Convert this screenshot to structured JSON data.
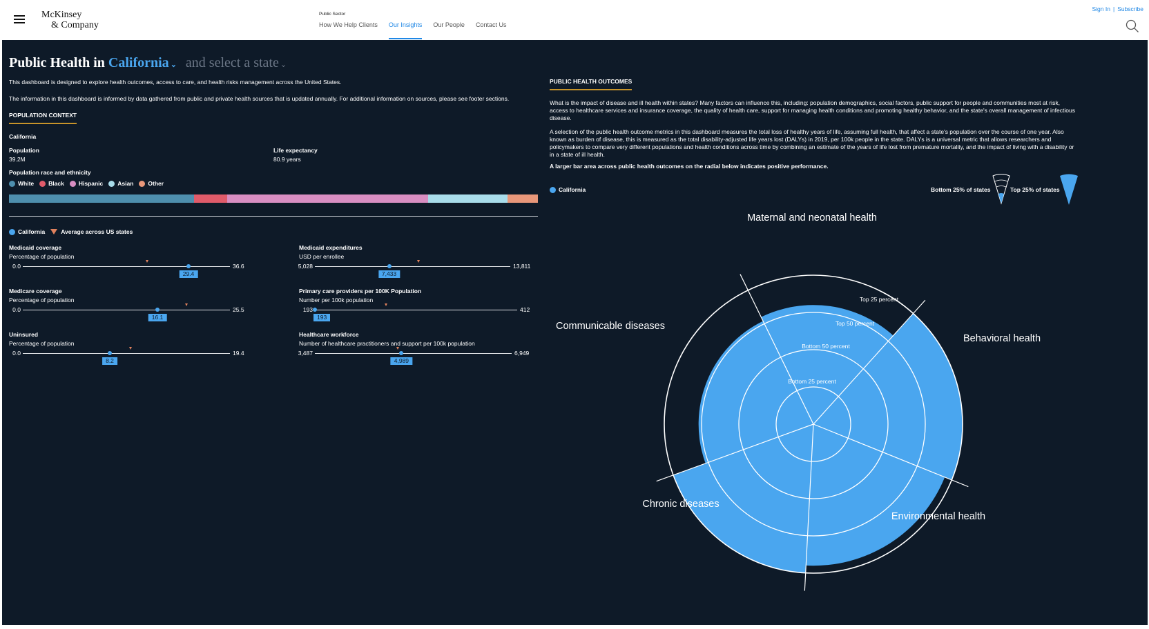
{
  "nav": {
    "logo_line1": "McKinsey",
    "logo_line2": "& Company",
    "sector": "Public Sector",
    "links": [
      "How We Help Clients",
      "Our Insights",
      "Our People",
      "Contact Us"
    ],
    "active_link": "Our Insights",
    "sign_in": "Sign In",
    "separator": "|",
    "subscribe": "Subscribe"
  },
  "header": {
    "title_prefix": "Public Health in",
    "state": "California",
    "caret": "⌄",
    "compare_placeholder": "and select a state"
  },
  "intro": {
    "p1": "This dashboard is designed to explore health outcomes, access to care, and health risks management across the United States.",
    "p2": "The information in this dashboard is informed by data gathered from public and private health sources that is updated annually. For additional information on sources, please see footer sections."
  },
  "population": {
    "heading": "POPULATION CONTEXT",
    "state": "California",
    "population_label": "Population",
    "population_value": "39.2M",
    "life_label": "Life expectancy",
    "life_value": "80.9 years",
    "race_label": "Population race and ethnicity",
    "race": [
      {
        "name": "White",
        "color": "#4e8fae",
        "share": 35
      },
      {
        "name": "Black",
        "color": "#e05b6a",
        "share": 6.2
      },
      {
        "name": "Hispanic",
        "color": "#d88ec2",
        "share": 38
      },
      {
        "name": "Asian",
        "color": "#a8dcea",
        "share": 15
      },
      {
        "name": "Other",
        "color": "#e8977a",
        "share": 5.8
      }
    ]
  },
  "metrics_legend": {
    "state": "California",
    "avg": "Average across US states"
  },
  "metrics": [
    {
      "title": "Medicaid coverage",
      "subtitle": "Percentage of population",
      "min": "0.0",
      "max": "36.6",
      "value": "29.4",
      "pos": 0.8,
      "avg": 0.6
    },
    {
      "title": "Medicaid expenditures",
      "subtitle": "USD per enrollee",
      "min": "5,028",
      "max": "13,811",
      "value": "7,433",
      "pos": 0.38,
      "avg": 0.53
    },
    {
      "title": "Medicare coverage",
      "subtitle": "Percentage of population",
      "min": "0.0",
      "max": "25.5",
      "value": "16.1",
      "pos": 0.65,
      "avg": 0.79
    },
    {
      "title": "Primary care providers per 100K Population",
      "subtitle": "Number per 100k population",
      "min": "193",
      "max": "412",
      "value": "193",
      "pos": 0.0,
      "avg": 0.35
    },
    {
      "title": "Uninsured",
      "subtitle": "Percentage of population",
      "min": "0.0",
      "max": "19.4",
      "value": "8.2",
      "pos": 0.42,
      "avg": 0.52
    },
    {
      "title": "Healthcare workforce",
      "subtitle": "Number of healthcare practitioners and support per 100k population",
      "min": "3,487",
      "max": "6,949",
      "value": "4,989",
      "pos": 0.44,
      "avg": 0.42
    }
  ],
  "outcomes": {
    "heading": "PUBLIC HEALTH OUTCOMES",
    "p1": "What is the impact of disease and ill health within states? Many factors can influence this, including: population demographics, social factors, public support for people and communities most at risk, access to healthcare services and insurance coverage, the quality of health care, support for managing health conditions and promoting healthy behavior, and the state's overall management of infectious disease.",
    "p2": "A selection of the public health outcome metrics in this dashboard measures the total loss of healthy years of life, assuming full health, that affect a state's population over the course of one year. Also known as burden of disease, this is measured as the total disability-adjusted life years lost (DALYs) in 2019, per 100k people in the state. DALYs is a universal metric that allows researchers and policymakers to compare very different populations and health conditions across time by combining an estimate of the years of life lost from premature mortality, and the impact of living with a disability or in a state of ill health.",
    "p3": "A larger bar area across public health outcomes on the radial below indicates positive performance.",
    "legend_state": "California",
    "bottom_label": "Bottom 25% of states",
    "top_label": "Top 25% of states",
    "rings": [
      "Bottom 25 percent",
      "Bottom 50 percent",
      "Top 50 percent",
      "Top 25 percent"
    ],
    "categories": [
      {
        "name": "Maternal and neonatal health",
        "level": 0.8
      },
      {
        "name": "Behavioral health",
        "level": 1.0
      },
      {
        "name": "Environmental health",
        "level": 0.95
      },
      {
        "name": "Chronic diseases",
        "level": 1.0
      },
      {
        "name": "Communicable diseases",
        "level": 0.77
      }
    ],
    "color": "#4aa6ef"
  }
}
